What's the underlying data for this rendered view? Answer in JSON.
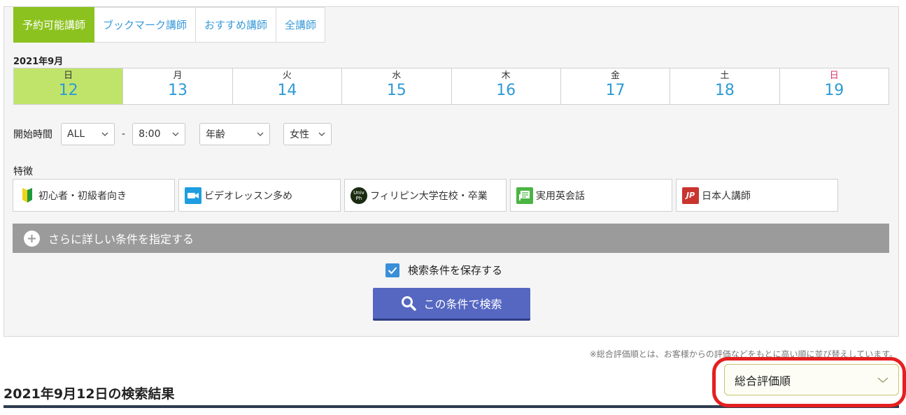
{
  "tabs": [
    {
      "label": "予約可能講師",
      "active": true
    },
    {
      "label": "ブックマーク講師",
      "active": false
    },
    {
      "label": "おすすめ講師",
      "active": false
    },
    {
      "label": "全講師",
      "active": false
    }
  ],
  "month_label": "2021年9月",
  "days": [
    {
      "name": "日",
      "num": "12",
      "active": true
    },
    {
      "name": "月",
      "num": "13"
    },
    {
      "name": "火",
      "num": "14"
    },
    {
      "name": "水",
      "num": "15"
    },
    {
      "name": "木",
      "num": "16"
    },
    {
      "name": "金",
      "num": "17"
    },
    {
      "name": "土",
      "num": "18"
    },
    {
      "name": "日",
      "num": "19",
      "holiday": true
    }
  ],
  "filters": {
    "start_time_label": "開始時間",
    "start_value": "ALL",
    "separator": "-",
    "end_value": "8:00",
    "age_value": "年齢",
    "gender_value": "女性"
  },
  "features_label": "特徴",
  "features": [
    {
      "label": "初心者・初級者向き",
      "icon": "beginner-mark-icon"
    },
    {
      "label": "ビデオレッスン多め",
      "icon": "video-camera-icon"
    },
    {
      "label": "フィリピン大学在校・卒業",
      "icon": "univ-ph-icon",
      "icon_text": [
        "Univ",
        "Ph"
      ]
    },
    {
      "label": "実用英会話",
      "icon": "conversation-icon"
    },
    {
      "label": "日本人講師",
      "icon": "jp-icon",
      "icon_text": "JP"
    }
  ],
  "more_conditions_label": "さらに詳しい条件を指定する",
  "save_conditions_label": "検索条件を保存する",
  "save_checked": true,
  "search_button_label": "この条件で検索",
  "sort_note": "※総合評価順とは、お客様からの評価などをもとに高い順に並び替えしています。",
  "results_title": "2021年9月12日の検索結果",
  "sort_value": "総合評価順",
  "colors": {
    "active_tab": "#8cc21f",
    "active_day": "#c0e46a",
    "day_number": "#2d9bd5",
    "search_button": "#5567c1",
    "highlight_ring": "#e51f20"
  }
}
